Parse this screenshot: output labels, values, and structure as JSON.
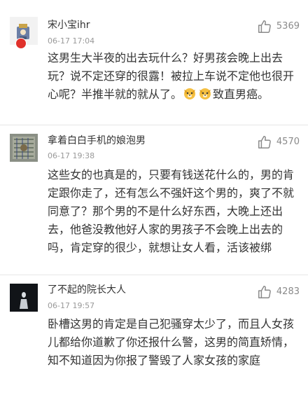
{
  "comments": [
    {
      "username": "宋小宝ihr",
      "time": "06-17 17:04",
      "likes": "5369",
      "text_main": "这男生大半夜的出去玩什么？好男孩会晚上出去玩？说不定还穿的很露！被拉上车说不定他也很开心呢？半推半就的就从了。",
      "emoji": [
        "dog-face-emoji",
        "dog-face-emoji"
      ],
      "text_tail": "致直男癌。"
    },
    {
      "username": "拿着白白手机的娘泡男",
      "time": "06-17 19:38",
      "likes": "4570",
      "text_main": "这些女的也真是的，只要有钱送花什么的，男的肯定跟你走了，还有怎么不强奸这个男的，爽了不就同意了？那个男的不是什么好东西，大晚上还出去，他爸没教他好人家的男孩子不会晚上出去的吗，肯定穿的很少，就想让女人看，活该被绑"
    },
    {
      "username": "了不起的院长大人",
      "time": "06-17 19:57",
      "likes": "4283",
      "text_main": "卧槽这男的肯定是自己犯骚穿太少了，而且人女孩儿都给你道歉了你还报什么警，这男的简直矫情，知不知道因为你报了警毁了人家女孩的家庭"
    }
  ],
  "colors": {
    "text": "#333333",
    "meta": "#999999",
    "like": "#8a8a8a",
    "divider": "#e6e6e6",
    "badge": "#e0312b"
  }
}
